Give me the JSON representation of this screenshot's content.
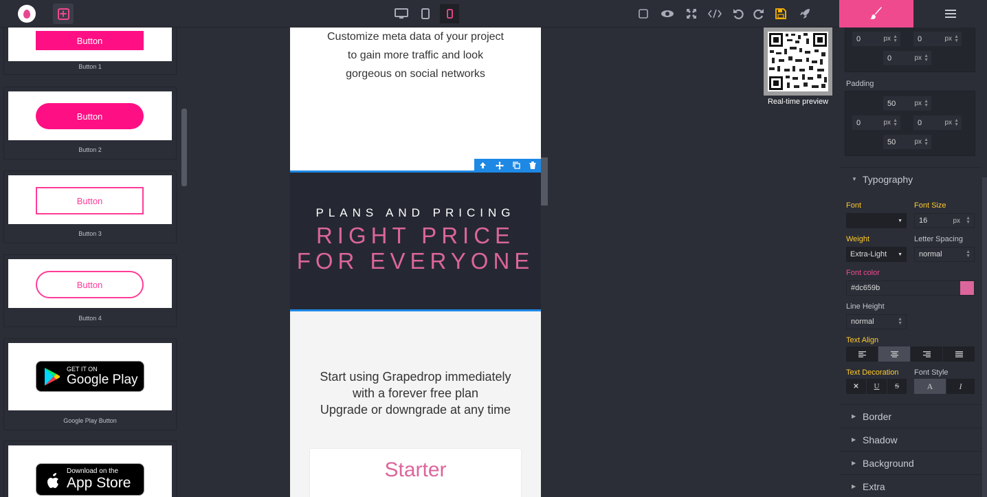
{
  "left_panel": {
    "blocks": [
      {
        "thumb_label": "Button",
        "caption": "Button 1"
      },
      {
        "thumb_label": "Button",
        "caption": "Button 2"
      },
      {
        "thumb_label": "Button",
        "caption": "Button 3"
      },
      {
        "thumb_label": "Button",
        "caption": "Button 4"
      },
      {
        "thumb_small": "GET IT ON",
        "thumb_big": "Google Play",
        "caption": "Google Play Button"
      },
      {
        "thumb_small": "Download on the",
        "thumb_big": "App Store",
        "caption": ""
      }
    ]
  },
  "canvas": {
    "intro_lines": [
      "Customize meta data of your project",
      "to gain more traffic and look",
      "gorgeous on social networks"
    ],
    "plans_kicker": "PLANS AND PRICING",
    "plans_title_1": "RIGHT PRICE",
    "plans_title_2": "FOR EVERYONE",
    "body_lines": [
      "Start using Grapedrop immediately",
      "with a forever free plan",
      "Upgrade or downgrade at any time"
    ],
    "card_title": "Starter"
  },
  "preview": {
    "label": "Real-time preview"
  },
  "style_panel": {
    "margin": {
      "top_left": "0",
      "top_right": "0",
      "bottom": "0",
      "unit": "px"
    },
    "padding_label": "Padding",
    "padding": {
      "top": "50",
      "left": "0",
      "right": "0",
      "bottom": "50",
      "unit": "px"
    },
    "typography_label": "Typography",
    "font_label": "Font",
    "font_value": "",
    "font_size_label": "Font Size",
    "font_size_value": "16",
    "font_size_unit": "px",
    "weight_label": "Weight",
    "weight_value": "Extra-Light",
    "letter_spacing_label": "Letter Spacing",
    "letter_spacing_value": "normal",
    "font_color_label": "Font color",
    "font_color_value": "#dc659b",
    "line_height_label": "Line Height",
    "line_height_value": "normal",
    "text_align_label": "Text Align",
    "text_decoration_label": "Text Decoration",
    "font_style_label": "Font Style",
    "deco_none": "✕",
    "deco_underline": "U",
    "deco_strike": "S",
    "style_normal": "A",
    "style_italic": "I",
    "sections": [
      "Border",
      "Shadow",
      "Background",
      "Extra"
    ]
  },
  "colors": {
    "accent": "#f04a8f",
    "selection": "#1e88e5",
    "warning": "#ffb400",
    "swatch": "#dc659b"
  }
}
